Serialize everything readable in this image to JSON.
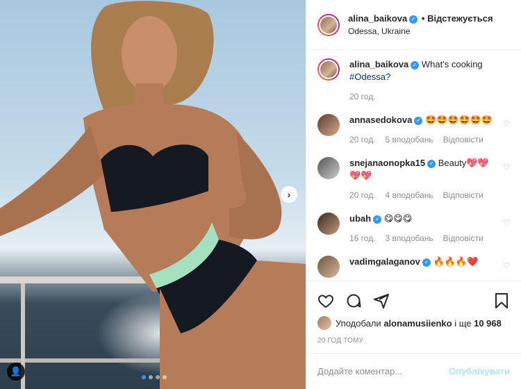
{
  "post": {
    "author": "alina_baikova",
    "follow_label": "• Відстежується",
    "location": "Odessa, Ukraine"
  },
  "caption": {
    "username": "alina_baikova",
    "text": "What's cooking",
    "hashtag": "#Odessa?",
    "time": "20 год."
  },
  "comments": [
    {
      "username": "annasedokova",
      "text": "🤩🤩🤩🤩🤩🤩",
      "time": "20 год.",
      "likes": "5 вподобань",
      "reply": "Відповісти"
    },
    {
      "username": "snejanaonopka15",
      "text": "Beauty💖💖💖💖",
      "time": "20 год.",
      "likes": "4 вподобань",
      "reply": "Відповісти"
    },
    {
      "username": "ubah",
      "text": "😋😋😋",
      "time": "16 год.",
      "likes": "3 вподобань",
      "reply": "Відповісти"
    },
    {
      "username": "vadimgalaganov",
      "text": "🔥🔥🔥❤️",
      "time": "",
      "likes": "",
      "reply": ""
    }
  ],
  "likes_line": {
    "prefix": "Уподобали",
    "user": "alonamusiienko",
    "middle": "і ще",
    "count": "10 968"
  },
  "post_time": "20 год тому",
  "comment_box": {
    "placeholder": "Додайте коментар...",
    "publish_label": "Опублікувати"
  },
  "icons": {
    "like": "heart-icon",
    "comment": "comment-icon",
    "share": "share-icon",
    "save": "bookmark-icon",
    "next": "chevron-right-icon"
  },
  "colors": {
    "verified": "#3897f0",
    "link": "#00376b",
    "publish_disabled": "#b2dffc",
    "muted": "#8e8e8e"
  }
}
